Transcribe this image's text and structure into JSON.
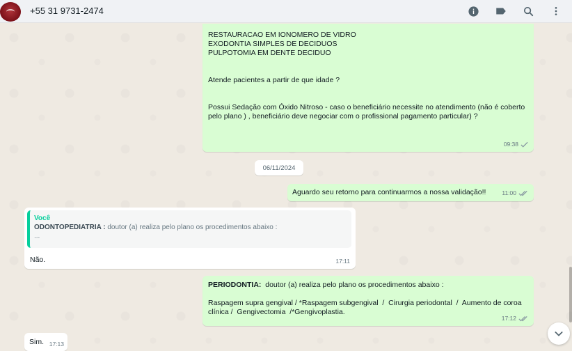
{
  "header": {
    "contact_name": "+55 31 9731-2474",
    "icons": [
      "info-icon",
      "label-icon",
      "search-icon",
      "menu-icon"
    ]
  },
  "colors": {
    "outgoing_bubble": "#d9fdd3",
    "incoming_bubble": "#ffffff",
    "quote_accent": "#06cf9c",
    "read_ticks": "#53bdeb",
    "chat_background": "#efeae2"
  },
  "messages": {
    "m1": {
      "lines": "RESTAURACAO EM IONOMERO DE VIDRO\nEXODONTIA SIMPLES DE DECIDUOS\nPULPOTOMIA EM DENTE DECIDUO\n\n\nAtende pacientes a partir de que idade ?\n\n\nPossui Sedação com Óxido Nitroso - caso o beneficiário necessite no atendimento (não é coberto pelo plano ) , beneficiário deve negociar com o profissional pagamento particular) ?",
      "time": "09:38"
    },
    "date_divider": "06/11/2024",
    "m2": {
      "text": "Aguardo seu retorno para continuarmos a nossa validação!!",
      "time": "11:00"
    },
    "m3": {
      "quote_author": "Você",
      "quote_bold": "ODONTOPEDIATRIA :",
      "quote_text": "  doutor (a) realiza pelo plano os procedimentos abaixo :",
      "quote_more": "...",
      "text": "Não.",
      "time": "17:11"
    },
    "m4": {
      "bold": "PERIODONTIA:",
      "text": "  doutor (a) realiza pelo plano os procedimentos abaixo :\n\nRaspagem supra gengival / *Raspagem subgengival  /  Cirurgia periodontal  /  Aumento de coroa clínica /  Gengivectomia  /*Gengivoplastia.",
      "time": "17:12"
    },
    "m5": {
      "text": "Sim.",
      "time": "17:13"
    }
  }
}
